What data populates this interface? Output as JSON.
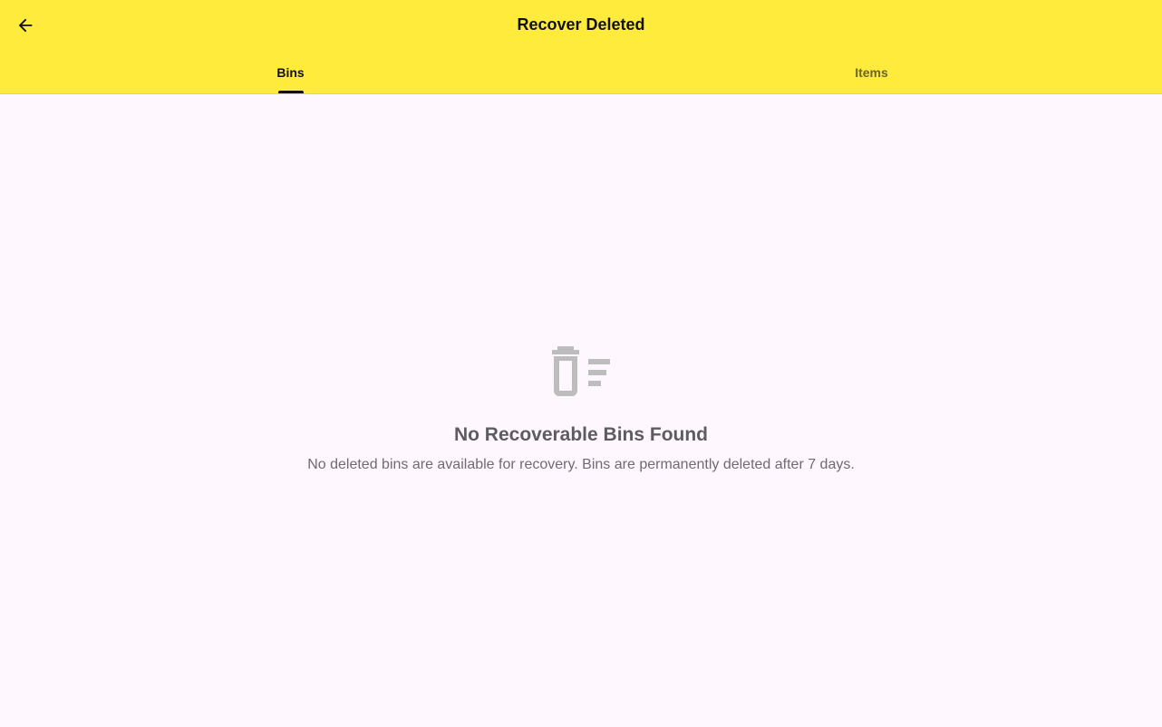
{
  "header": {
    "title": "Recover Deleted",
    "back_icon": "arrow-back-icon"
  },
  "tabs": [
    {
      "label": "Bins",
      "active": true
    },
    {
      "label": "Items",
      "active": false
    }
  ],
  "empty_state": {
    "icon": "delete-sweep-icon",
    "title": "No Recoverable Bins Found",
    "description": "No deleted bins are available for recovery. Bins are permanently deleted after 7 days."
  },
  "colors": {
    "app_bar": "#ffeb3b",
    "background": "#fef7fd",
    "icon_gray": "#bdbdbd"
  }
}
